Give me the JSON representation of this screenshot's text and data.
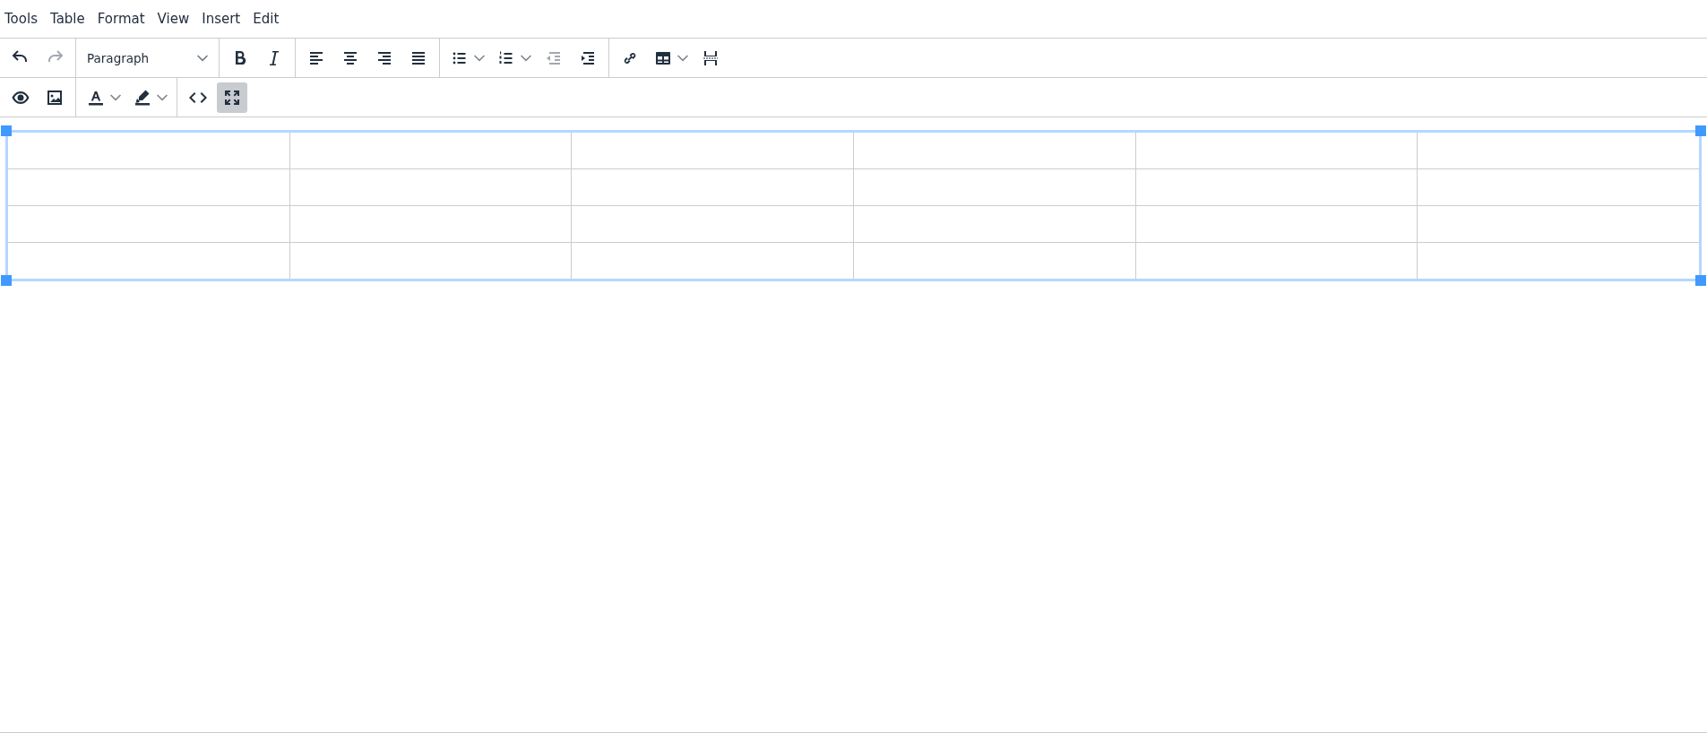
{
  "menubar": [
    {
      "label": "Tools"
    },
    {
      "label": "Table"
    },
    {
      "label": "Format"
    },
    {
      "label": "View"
    },
    {
      "label": "Insert"
    },
    {
      "label": "Edit"
    }
  ],
  "toolbar_rows": [
    {
      "groups": [
        {
          "items": [
            {
              "kind": "undo",
              "disabled": false,
              "active": false,
              "dropdown": false
            },
            {
              "kind": "redo",
              "disabled": true,
              "active": false,
              "dropdown": false
            }
          ]
        },
        {
          "items": [
            {
              "kind": "blocks",
              "value": "Paragraph",
              "disabled": false,
              "active": false,
              "dropdown": true
            }
          ]
        },
        {
          "items": [
            {
              "kind": "bold",
              "disabled": false,
              "active": false,
              "dropdown": false
            },
            {
              "kind": "italic",
              "disabled": false,
              "active": false,
              "dropdown": false
            }
          ]
        },
        {
          "items": [
            {
              "kind": "alignleft",
              "disabled": false,
              "active": false,
              "dropdown": false
            },
            {
              "kind": "aligncenter",
              "disabled": false,
              "active": false,
              "dropdown": false
            },
            {
              "kind": "alignright",
              "disabled": false,
              "active": false,
              "dropdown": false
            },
            {
              "kind": "alignjustify",
              "disabled": false,
              "active": false,
              "dropdown": false
            }
          ]
        },
        {
          "items": [
            {
              "kind": "bullist",
              "disabled": false,
              "active": false,
              "dropdown": true
            },
            {
              "kind": "numlist",
              "disabled": false,
              "active": false,
              "dropdown": true
            },
            {
              "kind": "outdent",
              "disabled": true,
              "active": false,
              "dropdown": false
            },
            {
              "kind": "indent",
              "disabled": false,
              "active": false,
              "dropdown": false
            }
          ]
        },
        {
          "items": [
            {
              "kind": "link",
              "disabled": false,
              "active": false,
              "dropdown": false
            },
            {
              "kind": "table",
              "disabled": false,
              "active": false,
              "dropdown": true
            },
            {
              "kind": "pagebreak",
              "disabled": false,
              "active": false,
              "dropdown": false
            }
          ]
        }
      ]
    },
    {
      "groups": [
        {
          "items": [
            {
              "kind": "preview",
              "disabled": false,
              "active": false,
              "dropdown": false
            },
            {
              "kind": "image",
              "disabled": false,
              "active": false,
              "dropdown": false
            }
          ]
        },
        {
          "items": [
            {
              "kind": "forecolor",
              "disabled": false,
              "active": false,
              "dropdown": true
            },
            {
              "kind": "backcolor",
              "disabled": false,
              "active": false,
              "dropdown": true
            }
          ]
        },
        {
          "items": [
            {
              "kind": "code",
              "disabled": false,
              "active": false,
              "dropdown": false
            },
            {
              "kind": "fullscreen",
              "disabled": false,
              "active": true,
              "dropdown": false
            }
          ]
        }
      ]
    }
  ],
  "table": {
    "selected": true,
    "rows": [
      {
        "cells": [
          {
            "selected": false
          },
          {
            "selected": false
          },
          {
            "selected": false
          },
          {
            "selected": false
          },
          {
            "selected": false
          },
          {
            "selected": false
          }
        ]
      },
      {
        "cells": [
          {
            "selected": false
          },
          {
            "selected": false
          },
          {
            "selected": false
          },
          {
            "selected": false
          },
          {
            "selected": false
          },
          {
            "selected": false
          }
        ]
      },
      {
        "cells": [
          {
            "selected": false
          },
          {
            "selected": false
          },
          {
            "selected": false
          },
          {
            "selected": false
          },
          {
            "selected": false
          },
          {
            "selected": false
          }
        ]
      },
      {
        "cells": [
          {
            "selected": false
          },
          {
            "selected": false
          },
          {
            "selected": false
          },
          {
            "selected": false
          },
          {
            "selected": false
          },
          {
            "selected": false
          }
        ]
      }
    ]
  }
}
